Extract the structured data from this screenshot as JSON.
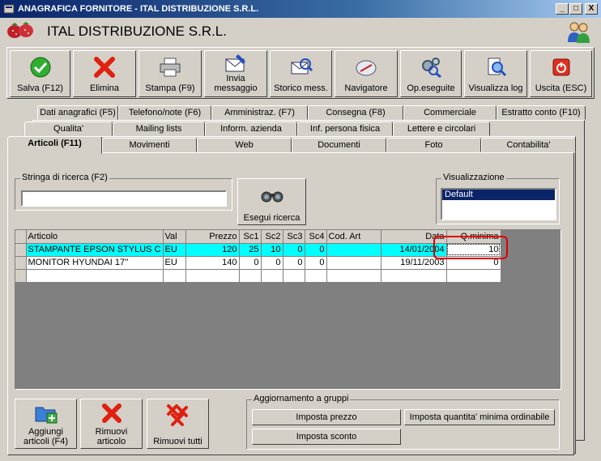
{
  "window": {
    "title": "ANAGRAFICA FORNITORE - ITAL DISTRIBUZIONE S.R.L.",
    "minimize": "_",
    "maximize": "□",
    "close": "X"
  },
  "header": {
    "title": "ITAL DISTRIBUZIONE S.R.L."
  },
  "toolbar": {
    "save": "Salva (F12)",
    "delete": "Elimina",
    "print": "Stampa (F9)",
    "send_line1": "Invia",
    "send_line2": "messaggio",
    "history": "Storico mess.",
    "navigator": "Navigatore",
    "operations": "Op.eseguite",
    "log": "Visualizza log",
    "exit": "Uscita (ESC)"
  },
  "tabs": {
    "row1": [
      "Dati anagrafici (F5)",
      "Telefono/note (F6)",
      "Amministraz. (F7)",
      "Consegna (F8)",
      "Commerciale",
      "Estratto conto (F10)"
    ],
    "row2": [
      "Qualita'",
      "Mailing lists",
      "Inform. azienda",
      "Inf. persona fisica",
      "Lettere e circolari"
    ],
    "row3": [
      "Articoli (F11)",
      "Movimenti",
      "Web",
      "Documenti",
      "Foto",
      "Contabilita'"
    ]
  },
  "search": {
    "label": "Stringa di ricerca (F2)",
    "value": "",
    "button": "Esegui ricerca"
  },
  "view": {
    "label": "Visualizzazione",
    "options": [
      "Default"
    ]
  },
  "grid": {
    "columns": [
      "Articolo",
      "Val",
      "Prezzo",
      "Sc1",
      "Sc2",
      "Sc3",
      "Sc4",
      "Cod. Art",
      "Data",
      "Q.minima"
    ],
    "rows": [
      [
        "STAMPANTE EPSON STYLUS C",
        "EU",
        "120",
        "25",
        "10",
        "0",
        "0",
        "",
        "14/01/2004",
        "10"
      ],
      [
        "MONITOR HYUNDAI 17''",
        "EU",
        "140",
        "0",
        "0",
        "0",
        "0",
        "",
        "19/11/2003",
        "0"
      ]
    ]
  },
  "bottom": {
    "add_line1": "Aggiungi",
    "add_line2": "articoli (F4)",
    "remove_line1": "Rimuovi",
    "remove_line2": "articolo",
    "remove_all": "Rimuovi tutti",
    "group_label": "Aggiornamento a gruppi",
    "set_price": "Imposta prezzo",
    "set_min_qty": "Imposta quantita' minima ordinabile",
    "set_discount": "Imposta sconto"
  },
  "colors": {
    "selected_row": "#00ffff",
    "highlight_outline": "#e00000",
    "title_bar": "#0a246a"
  }
}
